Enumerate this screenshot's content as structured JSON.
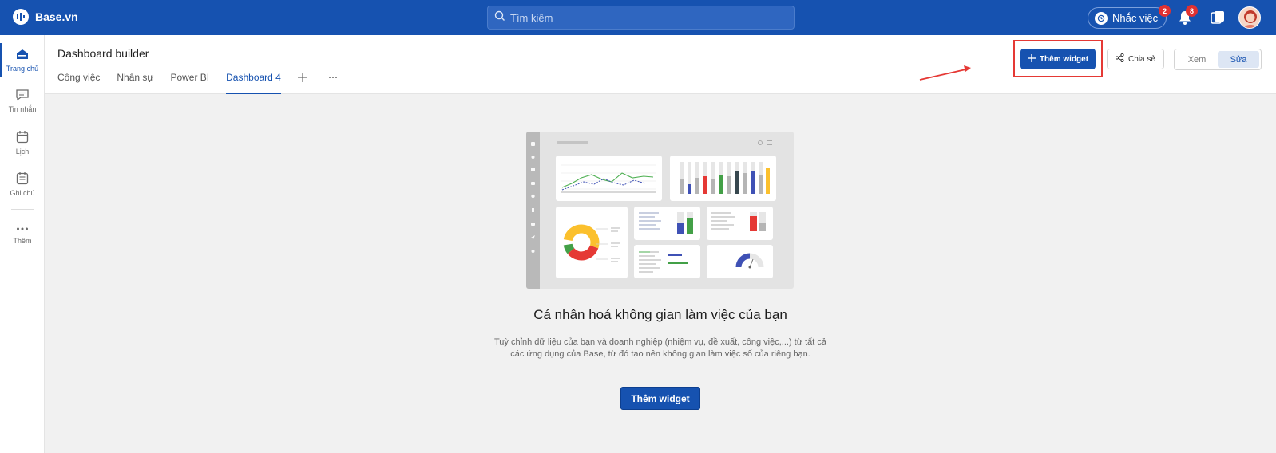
{
  "topbar": {
    "brand": "Base.vn",
    "search_placeholder": "Tìm kiếm",
    "remind_label": "Nhắc việc",
    "remind_count": "2",
    "notification_count": "8"
  },
  "sidebar": {
    "items": [
      {
        "label": "Trang chủ",
        "icon": "home-icon"
      },
      {
        "label": "Tin nhắn",
        "icon": "message-icon"
      },
      {
        "label": "Lịch",
        "icon": "calendar-icon"
      },
      {
        "label": "Ghi chú",
        "icon": "note-icon"
      },
      {
        "label": "Thêm",
        "icon": "more-icon"
      }
    ]
  },
  "header": {
    "title": "Dashboard builder",
    "tabs": [
      "Công việc",
      "Nhân sự",
      "Power BI",
      "Dashboard 4"
    ],
    "active_tab": "Dashboard 4",
    "add_widget_label": "Thêm widget",
    "share_label": "Chia sẻ",
    "view_label": "Xem",
    "edit_label": "Sửa",
    "mode_selected": "Sửa"
  },
  "main": {
    "empty_title": "Cá nhân hoá không gian làm việc của bạn",
    "empty_desc_line1": "Tuỳ chỉnh dữ liệu của bạn và doanh nghiệp (nhiệm vụ, đề xuất, công việc,...) từ tất cả",
    "empty_desc_line2": "các ứng dụng của Base, từ đó tạo nên không gian làm việc số của riêng bạn.",
    "cta_label": "Thêm widget"
  },
  "colors": {
    "brand": "#1652b0",
    "highlight": "#e53935",
    "badge": "#e03131"
  }
}
